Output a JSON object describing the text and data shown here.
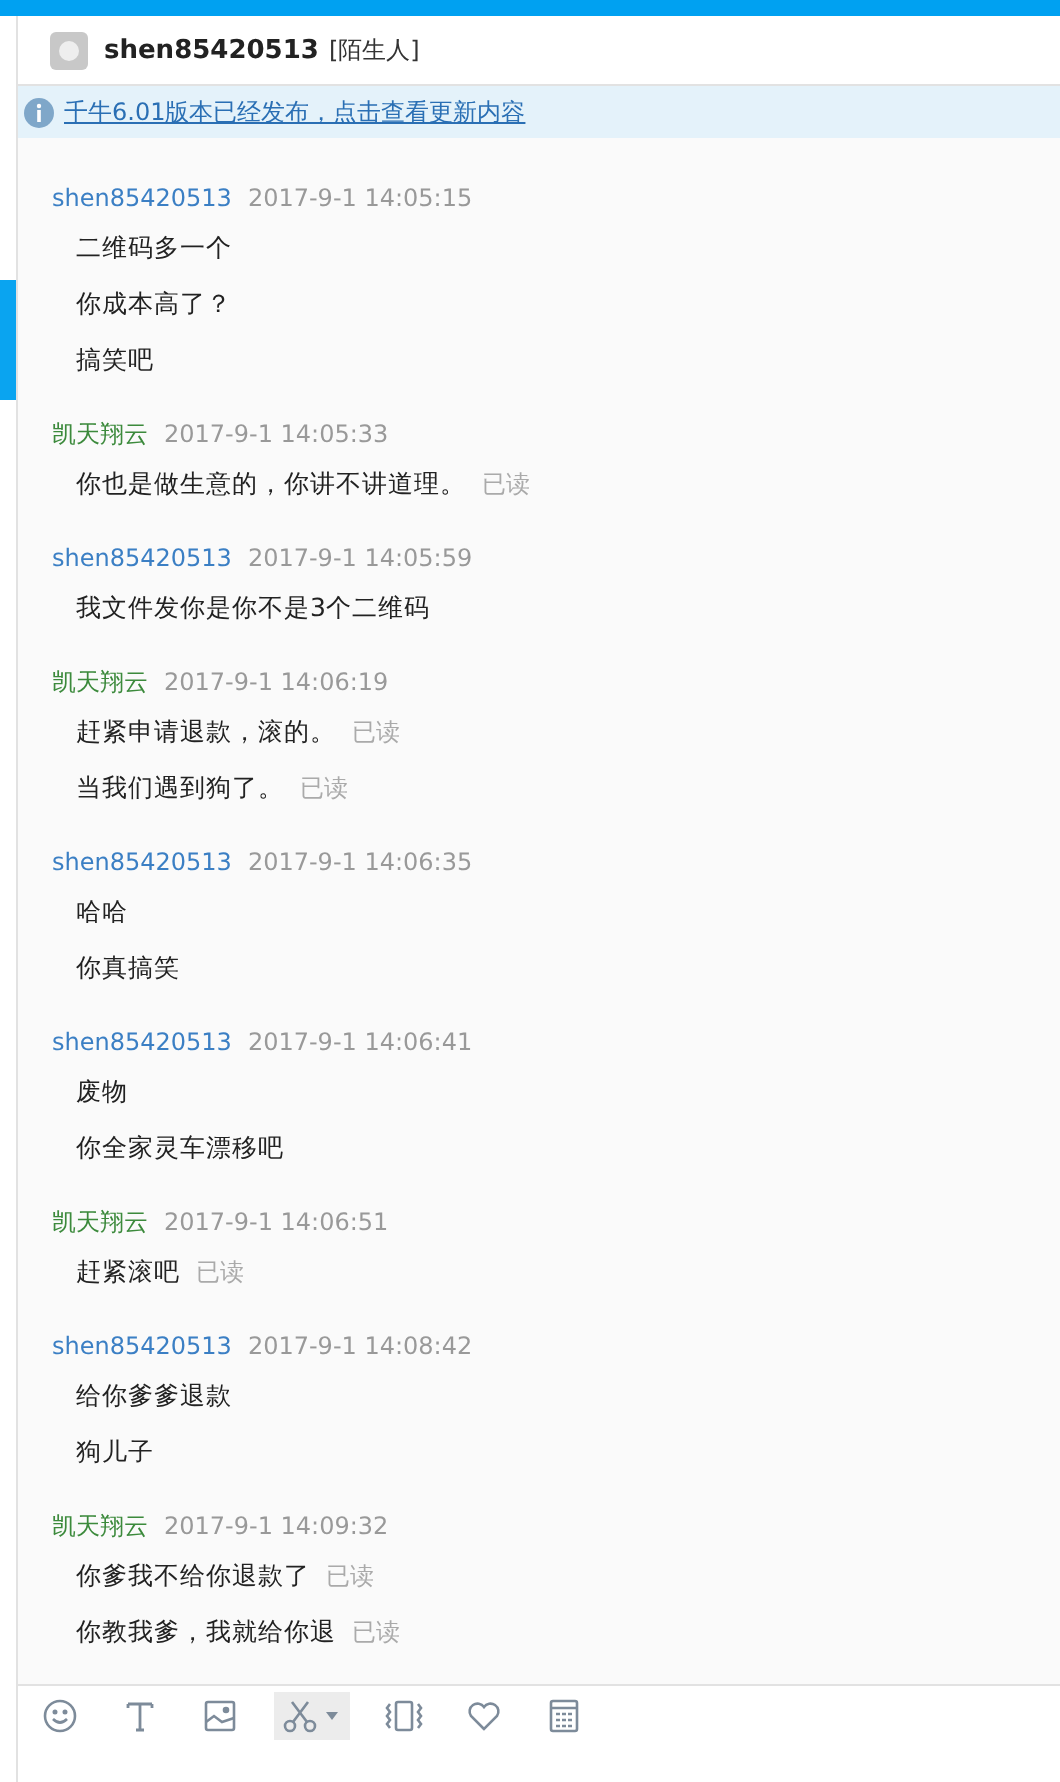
{
  "header": {
    "name": "shen85420513",
    "tag": "[陌生人]"
  },
  "notice": {
    "text": "千牛6.01版本已经发布，点击查看更新内容"
  },
  "messages": [
    {
      "sender": "shen85420513",
      "time": "2017-9-1 14:05:15",
      "color": "#3b7fc4",
      "lines": [
        {
          "text": "二维码多一个"
        },
        {
          "text": "你成本高了？"
        },
        {
          "text": "搞笑吧"
        }
      ]
    },
    {
      "sender": "凯天翔云",
      "time": "2017-9-1 14:05:33",
      "color": "#3c8a3c",
      "lines": [
        {
          "text": "你也是做生意的，你讲不讲道理。",
          "receipt": "已读"
        }
      ]
    },
    {
      "sender": "shen85420513",
      "time": "2017-9-1 14:05:59",
      "color": "#3b7fc4",
      "lines": [
        {
          "text": "我文件发你是你不是3个二维码"
        }
      ]
    },
    {
      "sender": "凯天翔云",
      "time": "2017-9-1 14:06:19",
      "color": "#3c8a3c",
      "lines": [
        {
          "text": "赶紧申请退款，滚的。",
          "receipt": "已读"
        },
        {
          "text": "当我们遇到狗了。",
          "receipt": "已读"
        }
      ]
    },
    {
      "sender": "shen85420513",
      "time": "2017-9-1 14:06:35",
      "color": "#3b7fc4",
      "lines": [
        {
          "text": "哈哈"
        },
        {
          "text": "你真搞笑"
        }
      ]
    },
    {
      "sender": "shen85420513",
      "time": "2017-9-1 14:06:41",
      "color": "#3b7fc4",
      "lines": [
        {
          "text": "废物"
        },
        {
          "text": "你全家灵车漂移吧"
        }
      ]
    },
    {
      "sender": "凯天翔云",
      "time": "2017-9-1 14:06:51",
      "color": "#3c8a3c",
      "lines": [
        {
          "text": "赶紧滚吧",
          "receipt": "已读"
        }
      ]
    },
    {
      "sender": "shen85420513",
      "time": "2017-9-1 14:08:42",
      "color": "#3b7fc4",
      "lines": [
        {
          "text": "给你爹爹退款"
        },
        {
          "text": "狗儿子"
        }
      ]
    },
    {
      "sender": "凯天翔云",
      "time": "2017-9-1 14:09:32",
      "color": "#3c8a3c",
      "lines": [
        {
          "text": "你爹我不给你退款了",
          "receipt": "已读"
        },
        {
          "text": "你教我爹，我就给你退",
          "receipt": "已读"
        }
      ]
    }
  ],
  "toolbar": [
    {
      "kind": "emoji",
      "selected": false
    },
    {
      "kind": "font",
      "selected": false
    },
    {
      "kind": "image",
      "selected": false
    },
    {
      "kind": "scissors",
      "selected": true
    },
    {
      "kind": "shake",
      "selected": false
    },
    {
      "kind": "heart",
      "selected": false
    },
    {
      "kind": "calculator",
      "selected": false
    }
  ]
}
